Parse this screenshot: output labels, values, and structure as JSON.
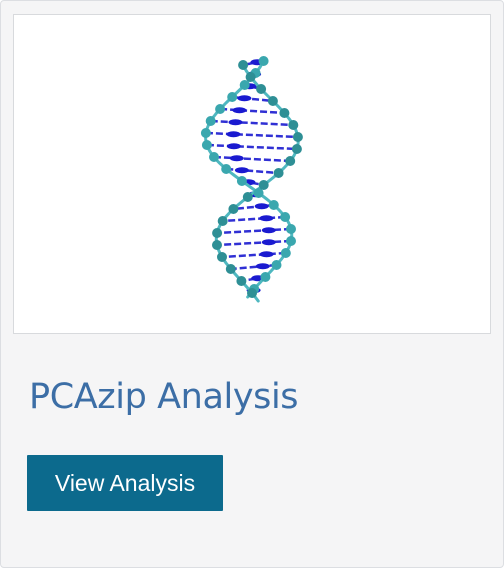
{
  "card": {
    "title": "PCAzip Analysis",
    "button_label": "View Analysis",
    "thumbnail_icon": "dna-double-helix-icon"
  },
  "colors": {
    "title": "#3c6ea6",
    "button": "#0c6a8d",
    "helix_backbone": "#4fb8c0",
    "helix_bases": "#1a1ad0"
  }
}
